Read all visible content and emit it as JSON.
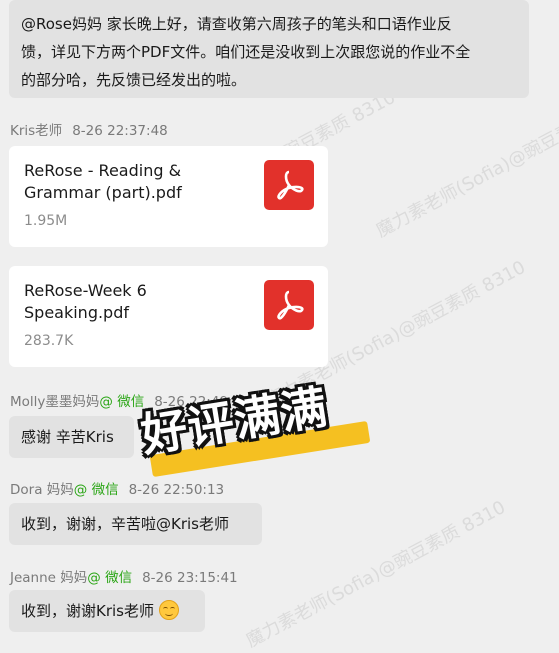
{
  "messages": [
    {
      "text_lines": [
        "@Rose妈妈  家长晚上好，请查收第六周孩子的笔头和口语作业反",
        "馈，详见下方两个PDF文件。咱们还是没收到上次跟您说的作业不全",
        "的部分哈，先反馈已经发出的啦。"
      ]
    },
    {
      "sender": "Kris老师",
      "time": "8-26 22:37:48",
      "files": [
        {
          "name": "ReRose - Reading & Grammar (part).pdf",
          "size": "1.95M",
          "icon": "pdf-icon"
        },
        {
          "name": "ReRose-Week 6 Speaking.pdf",
          "size": "283.7K",
          "icon": "pdf-icon"
        }
      ]
    },
    {
      "sender": "Molly墨墨妈妈",
      "tag": "@ 微信",
      "time": "8-26 22:49:09",
      "text": "感谢 辛苦Kris"
    },
    {
      "sender": "Dora 妈妈",
      "tag": "@ 微信",
      "time": "8-26 22:50:13",
      "text": "收到，谢谢，辛苦啦@Kris老师"
    },
    {
      "sender": "Jeanne 妈妈",
      "tag": "@ 微信",
      "time": "8-26 23:15:41",
      "text": "收到，谢谢Kris老师",
      "emoji": "smile-emoji"
    }
  ],
  "sticker": {
    "text": "好评满满"
  },
  "watermarks": [
    "魔力素老师(Sofia)@豌豆素质 8310",
    "魔力素老师(Sofia)@豌豆素质 8310",
    "魔力素老师(Sofia)@豌豆素质 8310",
    "魔力素老师(Sofia)@豌豆素质 8310"
  ],
  "colors": {
    "background": "#efefef",
    "bubble": "#e2e2e2",
    "wechat_tag": "#2aa515",
    "pdf": "#e2312b",
    "sticker_bar": "#f5c021"
  }
}
